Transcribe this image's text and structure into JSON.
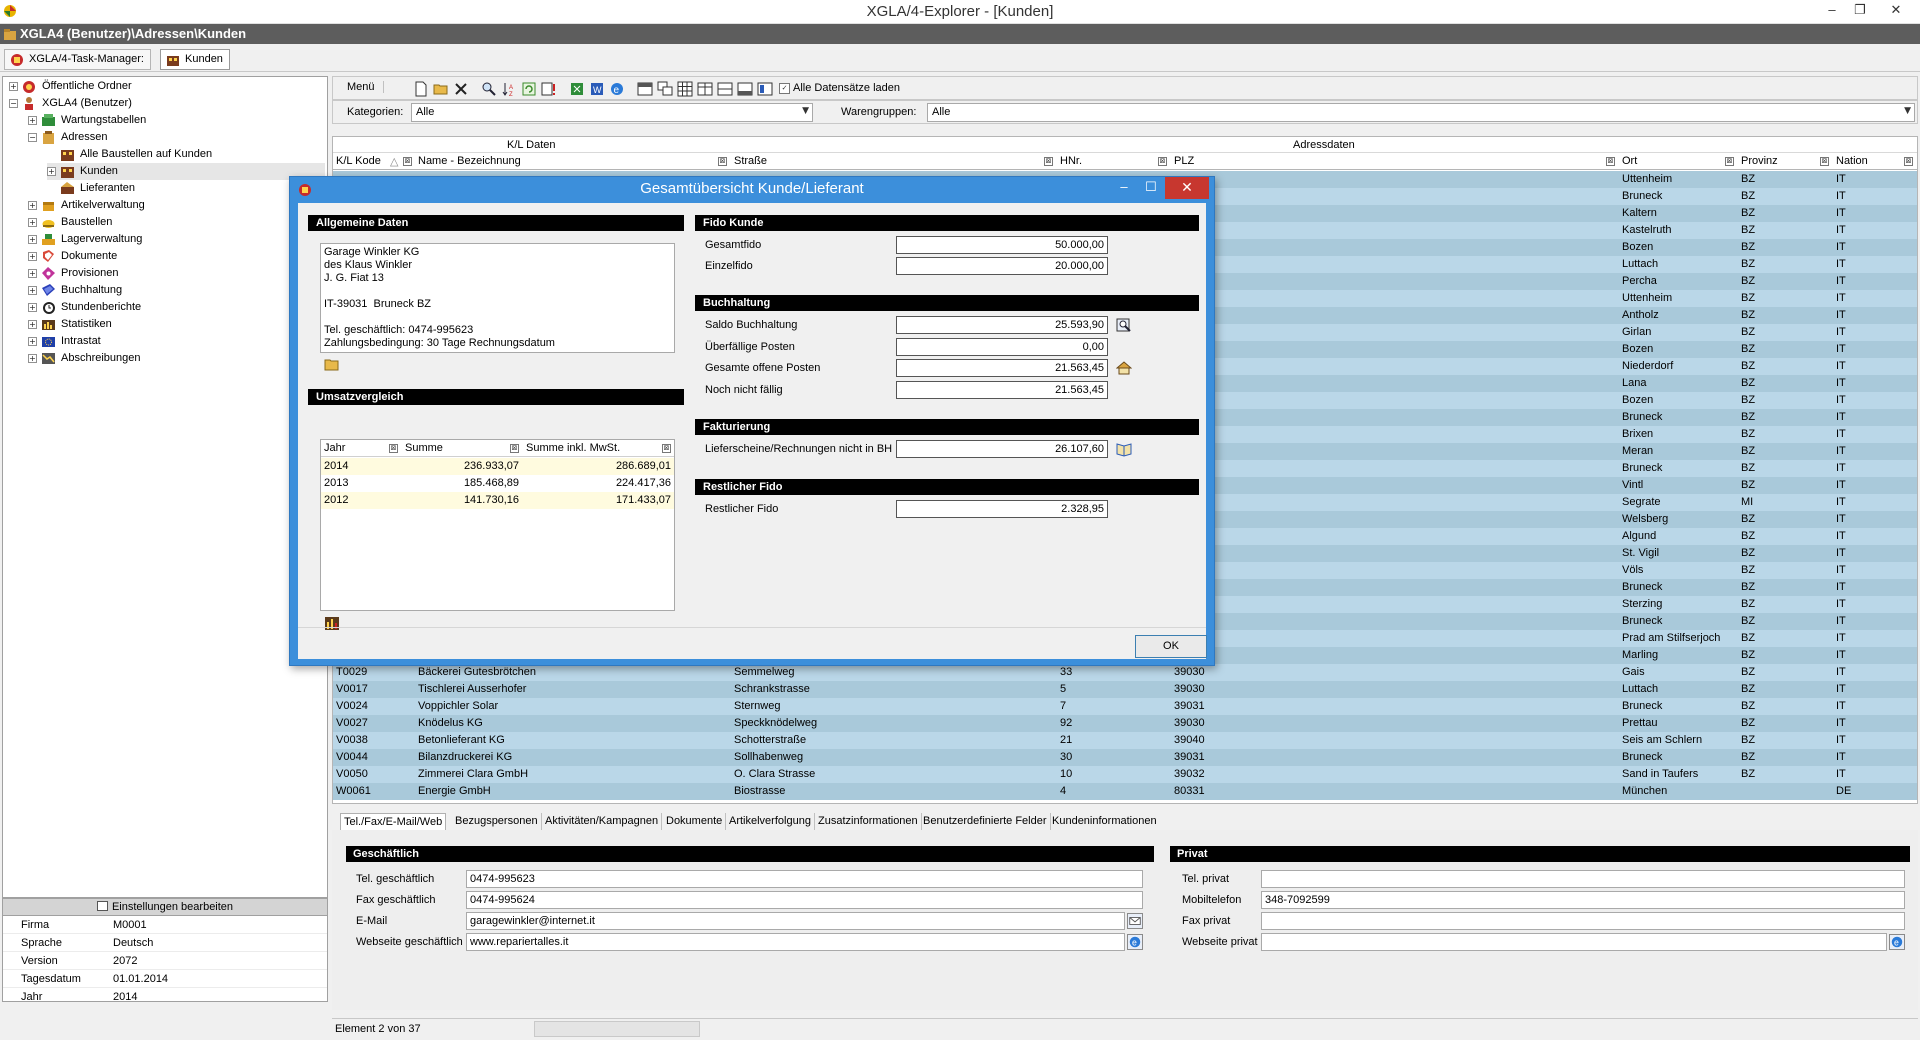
{
  "window": {
    "title": "XGLA/4-Explorer - [Kunden]",
    "minimize": "–",
    "restore": "❐",
    "close": "✕"
  },
  "path": "XGLA4 (Benutzer)\\Adressen\\Kunden",
  "taskbar": {
    "task_manager": "XGLA/4-Task-Manager:",
    "active": "Kunden"
  },
  "tree": [
    {
      "label": "Öffentliche Ordner",
      "exp": "+"
    },
    {
      "label": "XGLA4 (Benutzer)",
      "exp": "−"
    },
    {
      "label": "Wartungstabellen",
      "exp": "+"
    },
    {
      "label": "Adressen",
      "exp": "−"
    },
    {
      "label": "Alle Baustellen auf Kunden",
      "exp": ""
    },
    {
      "label": "Kunden",
      "exp": "+"
    },
    {
      "label": "Lieferanten",
      "exp": ""
    },
    {
      "label": "Artikelverwaltung",
      "exp": "+"
    },
    {
      "label": "Baustellen",
      "exp": "+"
    },
    {
      "label": "Lagerverwaltung",
      "exp": "+"
    },
    {
      "label": "Dokumente",
      "exp": "+"
    },
    {
      "label": "Provisionen",
      "exp": "+"
    },
    {
      "label": "Buchhaltung",
      "exp": "+"
    },
    {
      "label": "Stundenberichte",
      "exp": "+"
    },
    {
      "label": "Statistiken",
      "exp": "+"
    },
    {
      "label": "Intrastat",
      "exp": "+"
    },
    {
      "label": "Abschreibungen",
      "exp": "+"
    }
  ],
  "settings": {
    "header": "Einstellungen bearbeiten",
    "rows": [
      {
        "k": "Firma",
        "v": "M0001"
      },
      {
        "k": "Sprache",
        "v": "Deutsch"
      },
      {
        "k": "Version",
        "v": "2072"
      },
      {
        "k": "Tagesdatum",
        "v": "01.01.2014"
      },
      {
        "k": "Jahr",
        "v": "2014"
      }
    ]
  },
  "toolbar": {
    "menu": "Menü",
    "load_all": "Alle Datensätze laden",
    "load_all_checked": "✓"
  },
  "filters": {
    "kategorien_label": "Kategorien:",
    "kategorien_value": "Alle",
    "warengruppen_label": "Warengruppen:",
    "warengruppen_value": "Alle"
  },
  "grid": {
    "group1": "K/L Daten",
    "group2": "Adressdaten",
    "columns": [
      "K/L Kode",
      "Name - Bezeichnung",
      "Straße",
      "HNr.",
      "PLZ",
      "Ort",
      "Provinz",
      "Nation"
    ],
    "sort_indicator": "△",
    "rows": [
      {
        "kode": "",
        "name": "",
        "strasse": "",
        "hnr": "",
        "plz": "",
        "ort": "Uttenheim",
        "prov": "BZ",
        "nation": "IT"
      },
      {
        "kode": "",
        "name": "",
        "strasse": "",
        "hnr": "",
        "plz": "",
        "ort": "Bruneck",
        "prov": "BZ",
        "nation": "IT"
      },
      {
        "kode": "",
        "name": "",
        "strasse": "",
        "hnr": "",
        "plz": "",
        "ort": "Kaltern",
        "prov": "BZ",
        "nation": "IT"
      },
      {
        "kode": "",
        "name": "",
        "strasse": "",
        "hnr": "",
        "plz": "",
        "ort": "Kastelruth",
        "prov": "BZ",
        "nation": "IT"
      },
      {
        "kode": "",
        "name": "",
        "strasse": "",
        "hnr": "",
        "plz": "",
        "ort": "Bozen",
        "prov": "BZ",
        "nation": "IT"
      },
      {
        "kode": "",
        "name": "",
        "strasse": "",
        "hnr": "",
        "plz": "",
        "ort": "Luttach",
        "prov": "BZ",
        "nation": "IT"
      },
      {
        "kode": "",
        "name": "",
        "strasse": "",
        "hnr": "",
        "plz": "",
        "ort": "Percha",
        "prov": "BZ",
        "nation": "IT"
      },
      {
        "kode": "",
        "name": "",
        "strasse": "",
        "hnr": "",
        "plz": "",
        "ort": "Uttenheim",
        "prov": "BZ",
        "nation": "IT"
      },
      {
        "kode": "",
        "name": "",
        "strasse": "",
        "hnr": "",
        "plz": "",
        "ort": "Antholz",
        "prov": "BZ",
        "nation": "IT"
      },
      {
        "kode": "",
        "name": "",
        "strasse": "",
        "hnr": "",
        "plz": "",
        "ort": "Girlan",
        "prov": "BZ",
        "nation": "IT"
      },
      {
        "kode": "",
        "name": "",
        "strasse": "",
        "hnr": "",
        "plz": "",
        "ort": "Bozen",
        "prov": "BZ",
        "nation": "IT"
      },
      {
        "kode": "",
        "name": "",
        "strasse": "",
        "hnr": "",
        "plz": "",
        "ort": "Niederdorf",
        "prov": "BZ",
        "nation": "IT"
      },
      {
        "kode": "",
        "name": "",
        "strasse": "",
        "hnr": "",
        "plz": "",
        "ort": "Lana",
        "prov": "BZ",
        "nation": "IT"
      },
      {
        "kode": "",
        "name": "",
        "strasse": "",
        "hnr": "",
        "plz": "",
        "ort": "Bozen",
        "prov": "BZ",
        "nation": "IT"
      },
      {
        "kode": "",
        "name": "",
        "strasse": "",
        "hnr": "",
        "plz": "",
        "ort": "Bruneck",
        "prov": "BZ",
        "nation": "IT"
      },
      {
        "kode": "",
        "name": "",
        "strasse": "",
        "hnr": "",
        "plz": "",
        "ort": "Brixen",
        "prov": "BZ",
        "nation": "IT"
      },
      {
        "kode": "",
        "name": "",
        "strasse": "",
        "hnr": "",
        "plz": "",
        "ort": "Meran",
        "prov": "BZ",
        "nation": "IT"
      },
      {
        "kode": "",
        "name": "",
        "strasse": "",
        "hnr": "",
        "plz": "",
        "ort": "Bruneck",
        "prov": "BZ",
        "nation": "IT"
      },
      {
        "kode": "",
        "name": "",
        "strasse": "",
        "hnr": "",
        "plz": "",
        "ort": "Vintl",
        "prov": "BZ",
        "nation": "IT"
      },
      {
        "kode": "",
        "name": "",
        "strasse": "",
        "hnr": "",
        "plz": "",
        "ort": "Segrate",
        "prov": "MI",
        "nation": "IT"
      },
      {
        "kode": "",
        "name": "",
        "strasse": "",
        "hnr": "",
        "plz": "",
        "ort": "Welsberg",
        "prov": "BZ",
        "nation": "IT"
      },
      {
        "kode": "",
        "name": "",
        "strasse": "",
        "hnr": "",
        "plz": "",
        "ort": "Algund",
        "prov": "BZ",
        "nation": "IT"
      },
      {
        "kode": "",
        "name": "",
        "strasse": "",
        "hnr": "",
        "plz": "",
        "ort": "St. Vigil",
        "prov": "BZ",
        "nation": "IT"
      },
      {
        "kode": "",
        "name": "",
        "strasse": "",
        "hnr": "",
        "plz": "",
        "ort": "Völs",
        "prov": "BZ",
        "nation": "IT"
      },
      {
        "kode": "",
        "name": "",
        "strasse": "",
        "hnr": "",
        "plz": "",
        "ort": "Bruneck",
        "prov": "BZ",
        "nation": "IT"
      },
      {
        "kode": "",
        "name": "",
        "strasse": "",
        "hnr": "",
        "plz": "",
        "ort": "Sterzing",
        "prov": "BZ",
        "nation": "IT"
      },
      {
        "kode": "",
        "name": "",
        "strasse": "",
        "hnr": "",
        "plz": "",
        "ort": "Bruneck",
        "prov": "BZ",
        "nation": "IT"
      },
      {
        "kode": "",
        "name": "",
        "strasse": "",
        "hnr": "",
        "plz": "",
        "ort": "Prad am Stilfserjoch",
        "prov": "BZ",
        "nation": "IT"
      },
      {
        "kode": "",
        "name": "",
        "strasse": "",
        "hnr": "",
        "plz": "",
        "ort": "Marling",
        "prov": "BZ",
        "nation": "IT"
      },
      {
        "kode": "T0029",
        "name": "Bäckerei Gutesbrötchen",
        "strasse": "Semmelweg",
        "hnr": "33",
        "plz": "39030",
        "ort": "Gais",
        "prov": "BZ",
        "nation": "IT"
      },
      {
        "kode": "V0017",
        "name": "Tischlerei Ausserhofer",
        "strasse": "Schrankstrasse",
        "hnr": "5",
        "plz": "39030",
        "ort": "Luttach",
        "prov": "BZ",
        "nation": "IT"
      },
      {
        "kode": "V0024",
        "name": "Voppichler Solar",
        "strasse": "Sternweg",
        "hnr": "7",
        "plz": "39031",
        "ort": "Bruneck",
        "prov": "BZ",
        "nation": "IT"
      },
      {
        "kode": "V0027",
        "name": "Knödelus KG",
        "strasse": "Speckknödelweg",
        "hnr": "92",
        "plz": "39030",
        "ort": "Prettau",
        "prov": "BZ",
        "nation": "IT"
      },
      {
        "kode": "V0038",
        "name": "Betonlieferant KG",
        "strasse": "Schotterstraße",
        "hnr": "21",
        "plz": "39040",
        "ort": "Seis am Schlern",
        "prov": "BZ",
        "nation": "IT"
      },
      {
        "kode": "V0044",
        "name": "Bilanzdruckerei KG",
        "strasse": "Sollhabenweg",
        "hnr": "30",
        "plz": "39031",
        "ort": "Bruneck",
        "prov": "BZ",
        "nation": "IT"
      },
      {
        "kode": "V0050",
        "name": "Zimmerei Clara GmbH",
        "strasse": "O. Clara Strasse",
        "hnr": "10",
        "plz": "39032",
        "ort": "Sand in Taufers",
        "prov": "BZ",
        "nation": "IT"
      },
      {
        "kode": "W0061",
        "name": "Energie GmbH",
        "strasse": "Biostrasse",
        "hnr": "4",
        "plz": "80331",
        "ort": "München",
        "prov": "",
        "nation": "DE"
      }
    ]
  },
  "tabs": [
    "Tel./Fax/E-Mail/Web",
    "Bezugspersonen",
    "Aktivitäten/Kampagnen",
    "Dokumente",
    "Artikelverfolgung",
    "Zusatzinformationen",
    "Benutzerdefinierte Felder",
    "Kundeninformationen"
  ],
  "geschaeftlich": {
    "header": "Geschäftlich",
    "fields": [
      {
        "label": "Tel. geschäftlich",
        "value": "0474-995623"
      },
      {
        "label": "Fax geschäftlich",
        "value": "0474-995624"
      },
      {
        "label": "E-Mail",
        "value": "garagewinkler@internet.it"
      },
      {
        "label": "Webseite geschäftlich",
        "value": "www.repariertalles.it"
      }
    ]
  },
  "privat": {
    "header": "Privat",
    "fields": [
      {
        "label": "Tel. privat",
        "value": ""
      },
      {
        "label": "Mobiltelefon",
        "value": "348-7092599"
      },
      {
        "label": "Fax privat",
        "value": ""
      },
      {
        "label": "Webseite privat",
        "value": ""
      }
    ]
  },
  "status": "Element 2 von 37",
  "dialog": {
    "title": "Gesamtübersicht Kunde/Lieferant",
    "allgemeine": "Allgemeine Daten",
    "address": "Garage Winkler KG\ndes Klaus Winkler\nJ. G. Fiat 13\n\nIT-39031  Bruneck BZ\n\nTel. geschäftlich: 0474-995623\nZahlungsbedingung: 30 Tage Rechnungsdatum",
    "umsatz": "Umsatzvergleich",
    "umsatz_cols": [
      "Jahr",
      "Summe",
      "Summe inkl. MwSt."
    ],
    "umsatz_rows": [
      {
        "jahr": "2014",
        "summe": "236.933,07",
        "inkl": "286.689,01"
      },
      {
        "jahr": "2013",
        "summe": "185.468,89",
        "inkl": "224.417,36"
      },
      {
        "jahr": "2012",
        "summe": "141.730,16",
        "inkl": "171.433,07"
      }
    ],
    "fido_header": "Fido Kunde",
    "fido": [
      {
        "label": "Gesamtfido",
        "value": "50.000,00"
      },
      {
        "label": "Einzelfido",
        "value": "20.000,00"
      }
    ],
    "buch_header": "Buchhaltung",
    "buch": [
      {
        "label": "Saldo Buchhaltung",
        "value": "25.593,90"
      },
      {
        "label": "Überfällige Posten",
        "value": "0,00"
      },
      {
        "label": "Gesamte offene Posten",
        "value": "21.563,45"
      },
      {
        "label": "Noch nicht fällig",
        "value": "21.563,45"
      }
    ],
    "fakt_header": "Fakturierung",
    "fakt": [
      {
        "label": "Lieferscheine/Rechnungen nicht in BH",
        "value": "26.107,60"
      }
    ],
    "rest_header": "Restlicher Fido",
    "rest": [
      {
        "label": "Restlicher Fido",
        "value": "2.328,95"
      }
    ],
    "ok": "OK",
    "minimize": "–",
    "maximize": "☐",
    "close": "✕"
  },
  "colors": {
    "row_a": "#a9c9da",
    "row_b": "#bad7e8",
    "dialog_frame": "#3c8fdb",
    "close_red": "#c7372f"
  }
}
